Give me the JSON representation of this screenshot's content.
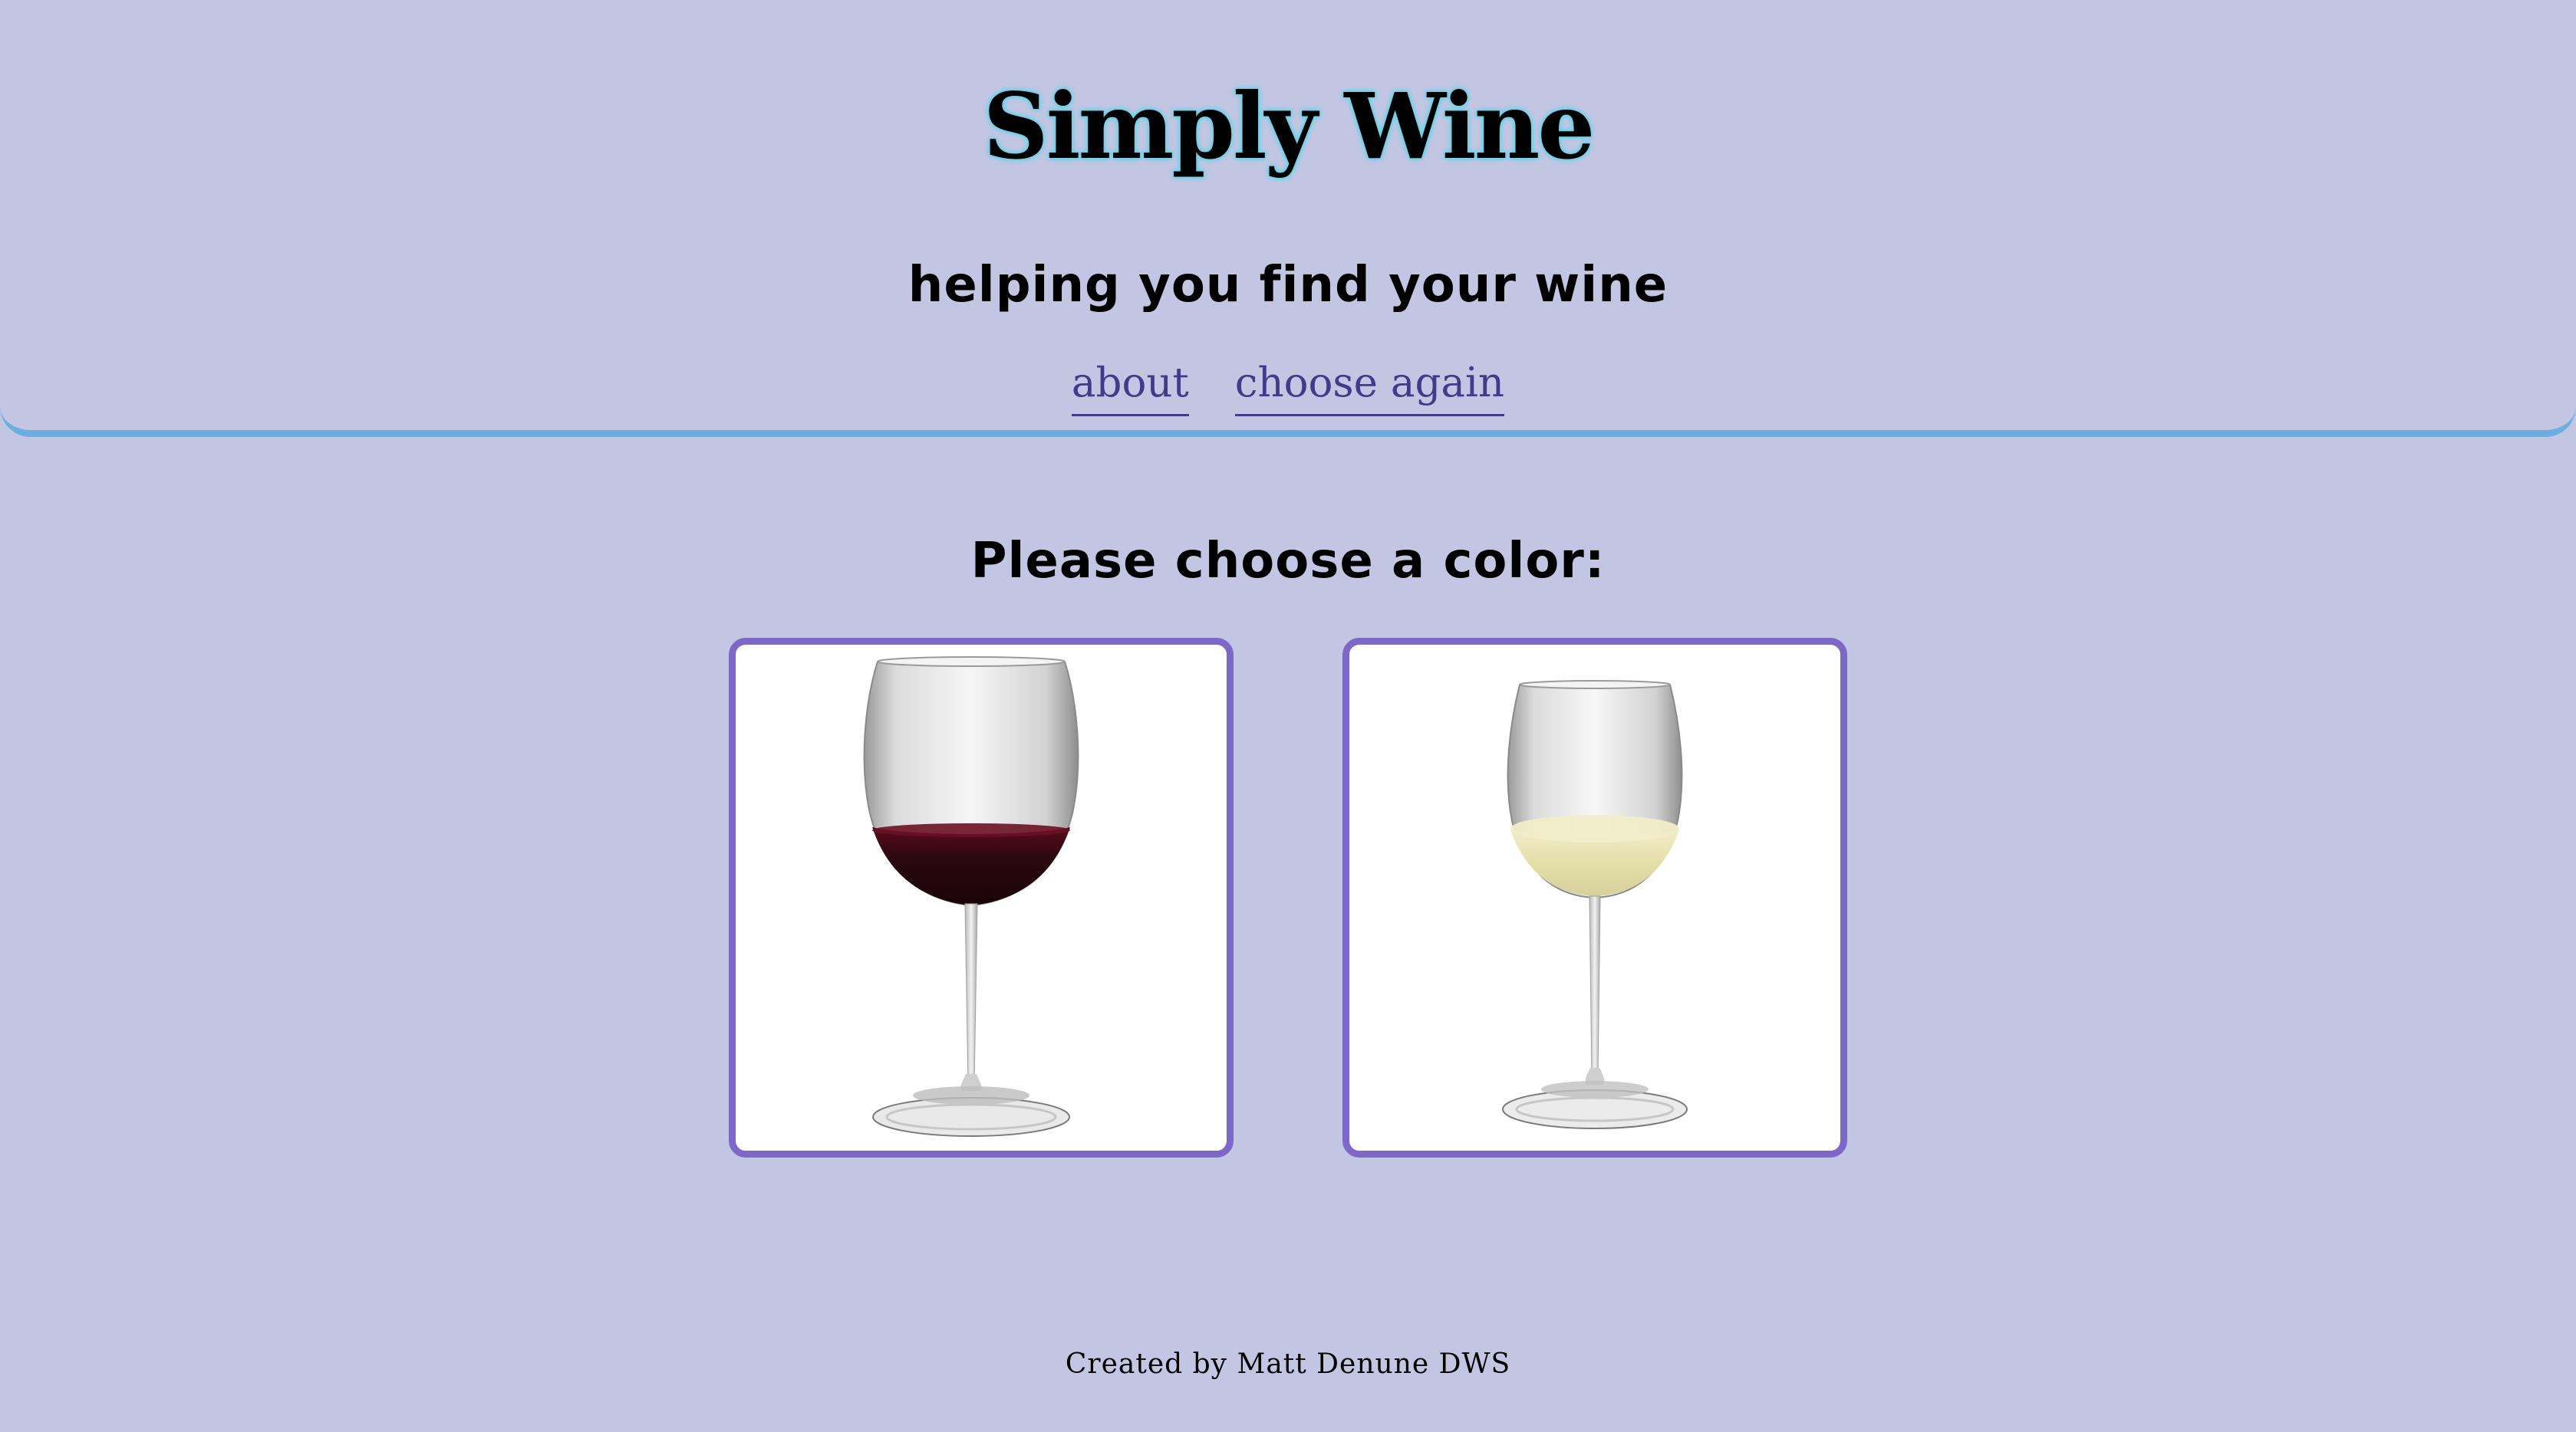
{
  "header": {
    "title": "Simply Wine",
    "tagline": "helping you find your wine",
    "nav": [
      {
        "label": "about"
      },
      {
        "label": "choose again"
      }
    ]
  },
  "main": {
    "prompt": "Please choose a color:",
    "choices": [
      {
        "name": "red-wine",
        "icon": "red-wine-glass-image",
        "wine_color": "#3a0710"
      },
      {
        "name": "white-wine",
        "icon": "white-wine-glass-image",
        "wine_color": "#e9e4b8"
      }
    ]
  },
  "footer": {
    "credit": "Created by Matt Denune DWS"
  },
  "colors": {
    "background": "#c3c6e2",
    "header_rule": "#6daee0",
    "card_border": "#7d68c7",
    "link": "#403b8a",
    "title_glow": "#5fd3ea"
  }
}
